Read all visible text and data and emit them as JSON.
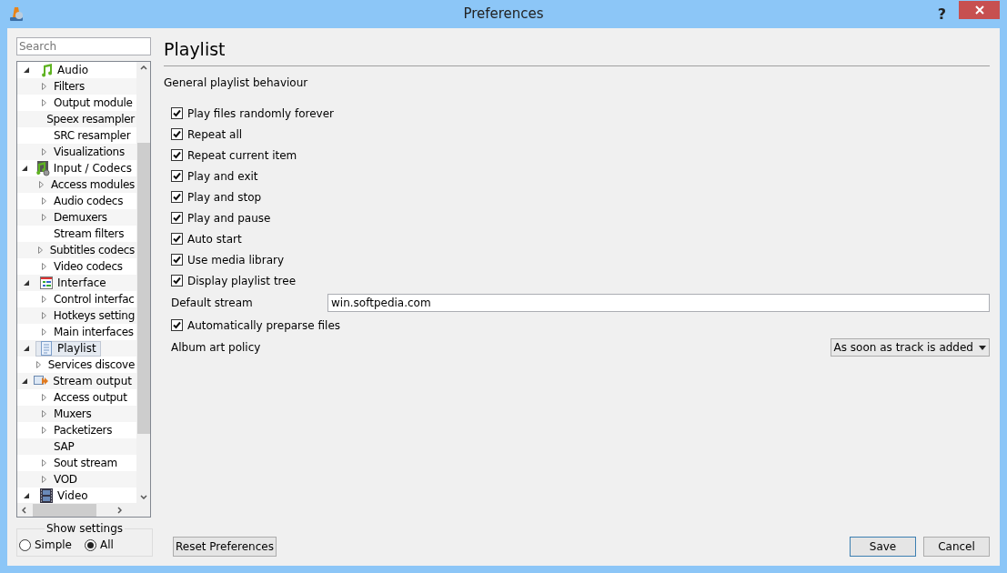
{
  "window": {
    "title": "Preferences",
    "help": "?"
  },
  "search": {
    "placeholder": "Search"
  },
  "tree": [
    {
      "label": "Audio",
      "kind": "audio",
      "expanded": true,
      "selected": false,
      "children": [
        {
          "label": "Filters",
          "expandable": true,
          "selected": false
        },
        {
          "label": "Output module",
          "expandable": true,
          "selected": false
        },
        {
          "label": "Speex resampler",
          "expandable": false,
          "selected": false
        },
        {
          "label": "SRC resampler",
          "expandable": false,
          "selected": false
        },
        {
          "label": "Visualizations",
          "expandable": true,
          "selected": false
        }
      ]
    },
    {
      "label": "Input / Codecs",
      "kind": "codecs",
      "expanded": true,
      "selected": false,
      "children": [
        {
          "label": "Access modules",
          "expandable": true,
          "selected": false
        },
        {
          "label": "Audio codecs",
          "expandable": true,
          "selected": false
        },
        {
          "label": "Demuxers",
          "expandable": true,
          "selected": false
        },
        {
          "label": "Stream filters",
          "expandable": false,
          "selected": false
        },
        {
          "label": "Subtitles codecs",
          "expandable": true,
          "selected": false
        },
        {
          "label": "Video codecs",
          "expandable": true,
          "selected": false
        }
      ]
    },
    {
      "label": "Interface",
      "kind": "interface",
      "expanded": true,
      "selected": false,
      "children": [
        {
          "label": "Control interfac",
          "expandable": true,
          "selected": false
        },
        {
          "label": "Hotkeys setting",
          "expandable": true,
          "selected": false
        },
        {
          "label": "Main interfaces",
          "expandable": true,
          "selected": false
        }
      ]
    },
    {
      "label": "Playlist",
      "kind": "playlist",
      "expanded": true,
      "selected": true,
      "children": [
        {
          "label": "Services discove",
          "expandable": true,
          "selected": false
        }
      ]
    },
    {
      "label": "Stream output",
      "kind": "stream",
      "expanded": true,
      "selected": false,
      "children": [
        {
          "label": "Access output",
          "expandable": true,
          "selected": false
        },
        {
          "label": "Muxers",
          "expandable": true,
          "selected": false
        },
        {
          "label": "Packetizers",
          "expandable": true,
          "selected": false
        },
        {
          "label": "SAP",
          "expandable": false,
          "selected": false
        },
        {
          "label": "Sout stream",
          "expandable": true,
          "selected": false
        },
        {
          "label": "VOD",
          "expandable": true,
          "selected": false
        }
      ]
    },
    {
      "label": "Video",
      "kind": "video",
      "expanded": true,
      "selected": false
    }
  ],
  "show_settings": {
    "title": "Show settings",
    "options": [
      {
        "label": "Simple",
        "selected": false
      },
      {
        "label": "All",
        "selected": true
      }
    ]
  },
  "panel": {
    "title": "Playlist",
    "section": "General playlist behaviour",
    "options": [
      {
        "kind": "checkbox",
        "label": "Play files randomly forever",
        "checked": true
      },
      {
        "kind": "checkbox",
        "label": "Repeat all",
        "checked": true
      },
      {
        "kind": "checkbox",
        "label": "Repeat current item",
        "checked": true
      },
      {
        "kind": "checkbox",
        "label": "Play and exit",
        "checked": true
      },
      {
        "kind": "checkbox",
        "label": "Play and stop",
        "checked": true
      },
      {
        "kind": "checkbox",
        "label": "Play and pause",
        "checked": true
      },
      {
        "kind": "checkbox",
        "label": "Auto start",
        "checked": true
      },
      {
        "kind": "checkbox",
        "label": "Use media library",
        "checked": true
      },
      {
        "kind": "checkbox",
        "label": "Display playlist tree",
        "checked": true
      },
      {
        "kind": "text",
        "label": "Default stream",
        "value": "win.softpedia.com"
      },
      {
        "kind": "checkbox",
        "label": "Automatically preparse files",
        "checked": true
      },
      {
        "kind": "select",
        "label": "Album art policy",
        "value": "As soon as track is added"
      }
    ]
  },
  "buttons": {
    "reset": "Reset Preferences",
    "save": "Save",
    "cancel": "Cancel"
  }
}
